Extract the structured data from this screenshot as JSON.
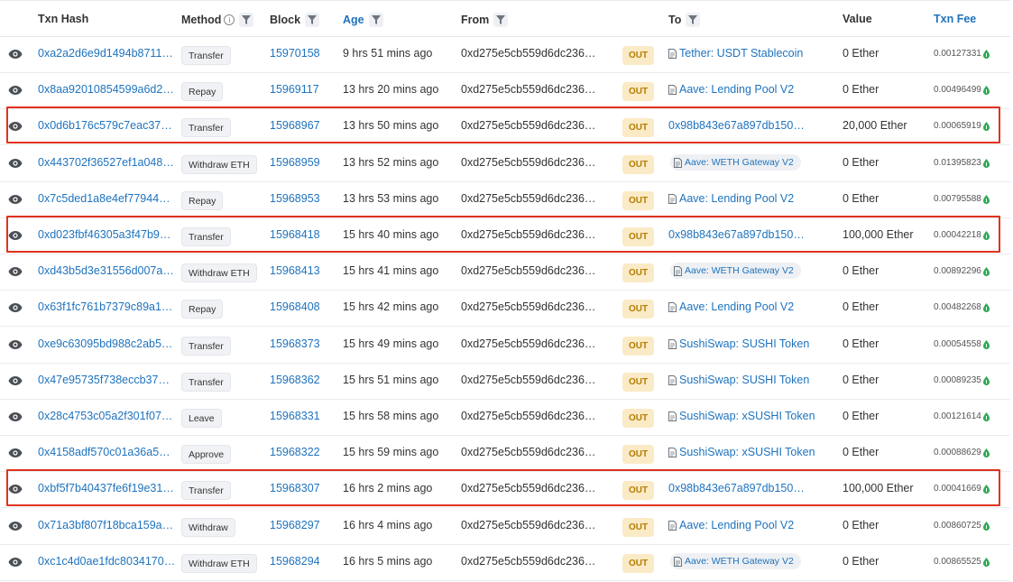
{
  "headers": {
    "txn_hash": "Txn Hash",
    "method": "Method",
    "block": "Block",
    "age": "Age",
    "from": "From",
    "to": "To",
    "value": "Value",
    "txn_fee": "Txn Fee"
  },
  "out_label": "OUT",
  "colors": {
    "link": "#1e73be",
    "out_bg": "#fbeac6",
    "out_text": "#b47d00",
    "highlight": "#e0321c"
  },
  "rows": [
    {
      "hash": "0xa2a2d6e9d1494b8711…",
      "method": "Transfer",
      "block": "15970158",
      "age": "9 hrs 51 mins ago",
      "from": "0xd275e5cb559d6dc236…",
      "to": "Tether: USDT Stablecoin",
      "to_style": "doc",
      "value": "0 Ether",
      "fee": "0.00127331",
      "highlighted": false
    },
    {
      "hash": "0x8aa92010854599a6d2…",
      "method": "Repay",
      "block": "15969117",
      "age": "13 hrs 20 mins ago",
      "from": "0xd275e5cb559d6dc236…",
      "to": "Aave: Lending Pool V2",
      "to_style": "doc",
      "value": "0 Ether",
      "fee": "0.00496499",
      "highlighted": false
    },
    {
      "hash": "0x0d6b176c579c7eac37…",
      "method": "Transfer",
      "block": "15968967",
      "age": "13 hrs 50 mins ago",
      "from": "0xd275e5cb559d6dc236…",
      "to": "0x98b843e67a897db150…",
      "to_style": "plain",
      "value": "20,000 Ether",
      "fee": "0.00065919",
      "highlighted": true
    },
    {
      "hash": "0x443702f36527ef1a048…",
      "method": "Withdraw ETH",
      "block": "15968959",
      "age": "13 hrs 52 mins ago",
      "from": "0xd275e5cb559d6dc236…",
      "to": "Aave: WETH Gateway V2",
      "to_style": "pill",
      "value": "0 Ether",
      "fee": "0.01395823",
      "highlighted": false
    },
    {
      "hash": "0x7c5ded1a8e4ef77944…",
      "method": "Repay",
      "block": "15968953",
      "age": "13 hrs 53 mins ago",
      "from": "0xd275e5cb559d6dc236…",
      "to": "Aave: Lending Pool V2",
      "to_style": "doc",
      "value": "0 Ether",
      "fee": "0.00795588",
      "highlighted": false
    },
    {
      "hash": "0xd023fbf46305a3f47b9…",
      "method": "Transfer",
      "block": "15968418",
      "age": "15 hrs 40 mins ago",
      "from": "0xd275e5cb559d6dc236…",
      "to": "0x98b843e67a897db150…",
      "to_style": "plain",
      "value": "100,000 Ether",
      "fee": "0.00042218",
      "highlighted": true
    },
    {
      "hash": "0xd43b5d3e31556d007a…",
      "method": "Withdraw ETH",
      "block": "15968413",
      "age": "15 hrs 41 mins ago",
      "from": "0xd275e5cb559d6dc236…",
      "to": "Aave: WETH Gateway V2",
      "to_style": "pill",
      "value": "0 Ether",
      "fee": "0.00892296",
      "highlighted": false
    },
    {
      "hash": "0x63f1fc761b7379c89a1…",
      "method": "Repay",
      "block": "15968408",
      "age": "15 hrs 42 mins ago",
      "from": "0xd275e5cb559d6dc236…",
      "to": "Aave: Lending Pool V2",
      "to_style": "doc",
      "value": "0 Ether",
      "fee": "0.00482268",
      "highlighted": false
    },
    {
      "hash": "0xe9c63095bd988c2ab5…",
      "method": "Transfer",
      "block": "15968373",
      "age": "15 hrs 49 mins ago",
      "from": "0xd275e5cb559d6dc236…",
      "to": "SushiSwap: SUSHI Token",
      "to_style": "doc",
      "value": "0 Ether",
      "fee": "0.00054558",
      "highlighted": false
    },
    {
      "hash": "0x47e95735f738eccb37…",
      "method": "Transfer",
      "block": "15968362",
      "age": "15 hrs 51 mins ago",
      "from": "0xd275e5cb559d6dc236…",
      "to": "SushiSwap: SUSHI Token",
      "to_style": "doc",
      "value": "0 Ether",
      "fee": "0.00089235",
      "highlighted": false
    },
    {
      "hash": "0x28c4753c05a2f301f07…",
      "method": "Leave",
      "block": "15968331",
      "age": "15 hrs 58 mins ago",
      "from": "0xd275e5cb559d6dc236…",
      "to": "SushiSwap: xSUSHI Token",
      "to_style": "doc",
      "value": "0 Ether",
      "fee": "0.00121614",
      "highlighted": false
    },
    {
      "hash": "0x4158adf570c01a36a5…",
      "method": "Approve",
      "block": "15968322",
      "age": "15 hrs 59 mins ago",
      "from": "0xd275e5cb559d6dc236…",
      "to": "SushiSwap: xSUSHI Token",
      "to_style": "doc",
      "value": "0 Ether",
      "fee": "0.00088629",
      "highlighted": false
    },
    {
      "hash": "0xbf5f7b40437fe6f19e31…",
      "method": "Transfer",
      "block": "15968307",
      "age": "16 hrs 2 mins ago",
      "from": "0xd275e5cb559d6dc236…",
      "to": "0x98b843e67a897db150…",
      "to_style": "plain",
      "value": "100,000 Ether",
      "fee": "0.00041669",
      "highlighted": true
    },
    {
      "hash": "0x71a3bf807f18bca159a…",
      "method": "Withdraw",
      "block": "15968297",
      "age": "16 hrs 4 mins ago",
      "from": "0xd275e5cb559d6dc236…",
      "to": "Aave: Lending Pool V2",
      "to_style": "doc",
      "value": "0 Ether",
      "fee": "0.00860725",
      "highlighted": false
    },
    {
      "hash": "0xc1c4d0ae1fdc8034170…",
      "method": "Withdraw ETH",
      "block": "15968294",
      "age": "16 hrs 5 mins ago",
      "from": "0xd275e5cb559d6dc236…",
      "to": "Aave: WETH Gateway V2",
      "to_style": "pill",
      "value": "0 Ether",
      "fee": "0.00865525",
      "highlighted": false
    }
  ]
}
